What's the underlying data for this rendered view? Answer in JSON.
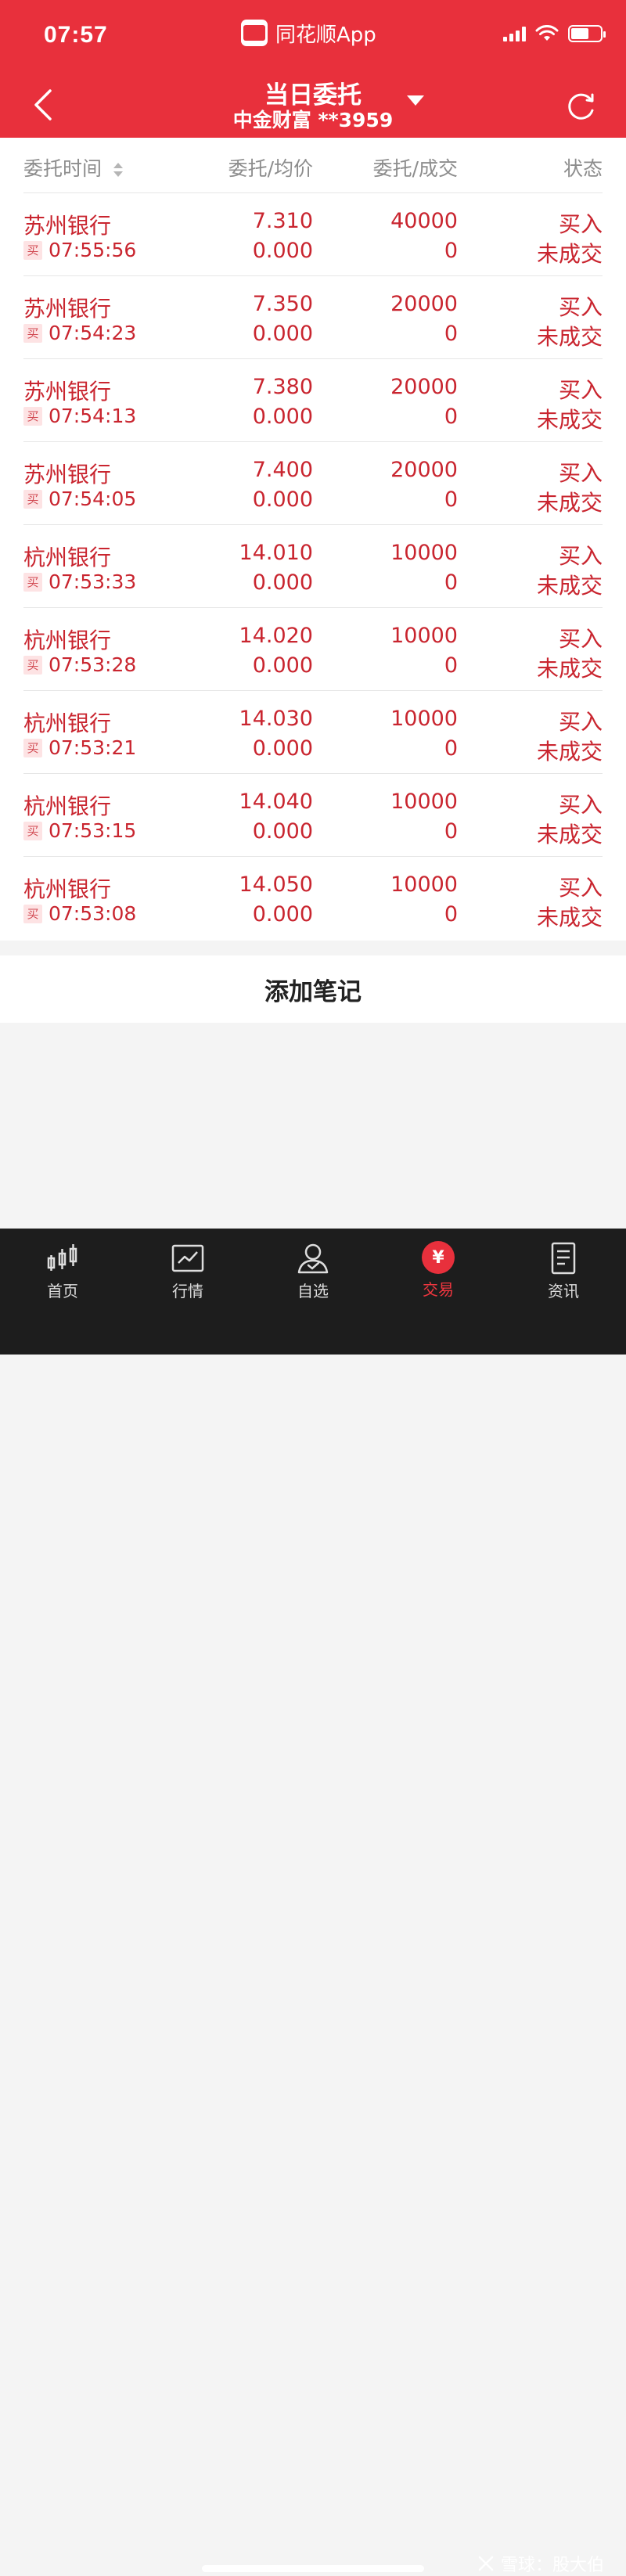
{
  "status_bar": {
    "time": "07:57",
    "app_name": "同花顺App"
  },
  "header": {
    "title": "当日委托",
    "subtitle": "中金财富 **3959"
  },
  "table": {
    "columns": [
      "委托时间",
      "委托/均价",
      "委托/成交",
      "状态"
    ],
    "rows": [
      {
        "name": "苏州银行",
        "side": "买",
        "time": "07:55:56",
        "price": "7.310",
        "avg": "0.000",
        "qty": "40000",
        "filled": "0",
        "direction": "买入",
        "status": "未成交"
      },
      {
        "name": "苏州银行",
        "side": "买",
        "time": "07:54:23",
        "price": "7.350",
        "avg": "0.000",
        "qty": "20000",
        "filled": "0",
        "direction": "买入",
        "status": "未成交"
      },
      {
        "name": "苏州银行",
        "side": "买",
        "time": "07:54:13",
        "price": "7.380",
        "avg": "0.000",
        "qty": "20000",
        "filled": "0",
        "direction": "买入",
        "status": "未成交"
      },
      {
        "name": "苏州银行",
        "side": "买",
        "time": "07:54:05",
        "price": "7.400",
        "avg": "0.000",
        "qty": "20000",
        "filled": "0",
        "direction": "买入",
        "status": "未成交"
      },
      {
        "name": "杭州银行",
        "side": "买",
        "time": "07:53:33",
        "price": "14.010",
        "avg": "0.000",
        "qty": "10000",
        "filled": "0",
        "direction": "买入",
        "status": "未成交"
      },
      {
        "name": "杭州银行",
        "side": "买",
        "time": "07:53:28",
        "price": "14.020",
        "avg": "0.000",
        "qty": "10000",
        "filled": "0",
        "direction": "买入",
        "status": "未成交"
      },
      {
        "name": "杭州银行",
        "side": "买",
        "time": "07:53:21",
        "price": "14.030",
        "avg": "0.000",
        "qty": "10000",
        "filled": "0",
        "direction": "买入",
        "status": "未成交"
      },
      {
        "name": "杭州银行",
        "side": "买",
        "time": "07:53:15",
        "price": "14.040",
        "avg": "0.000",
        "qty": "10000",
        "filled": "0",
        "direction": "买入",
        "status": "未成交"
      },
      {
        "name": "杭州银行",
        "side": "买",
        "time": "07:53:08",
        "price": "14.050",
        "avg": "0.000",
        "qty": "10000",
        "filled": "0",
        "direction": "买入",
        "status": "未成交"
      }
    ]
  },
  "add_note_label": "添加笔记",
  "tabbar": {
    "items": [
      {
        "label": "首页",
        "icon": "candlestick-icon"
      },
      {
        "label": "行情",
        "icon": "chart-line-icon"
      },
      {
        "label": "自选",
        "icon": "user-icon"
      },
      {
        "label": "交易",
        "icon": "yen-icon",
        "active": true
      },
      {
        "label": "资讯",
        "icon": "document-icon"
      }
    ],
    "trade_symbol": "¥"
  },
  "watermark": "雪球：股大伯",
  "colors": {
    "brand_red": "#e8303c",
    "text_red": "#c9252f",
    "tab_bg": "#1d1d1d"
  }
}
